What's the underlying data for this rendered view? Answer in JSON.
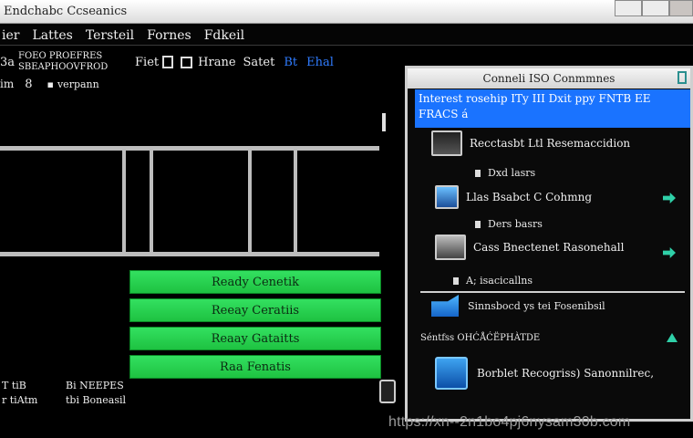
{
  "window": {
    "title": "Endchabc Ccseanics"
  },
  "menubar": {
    "items": [
      "ier",
      "Lattes",
      "Tersteil",
      "Fornes",
      "Fdkeil"
    ]
  },
  "toolbar": {
    "left_code": "3a",
    "left_text": "FOEO PROEFRES SBEAPHOOVFROD",
    "fiet": "Fiet",
    "hrane": "Hrane",
    "satet": "Satet",
    "bt": "Bt",
    "ehal": "Ehal",
    "row2_a": "im",
    "row2_b": "8",
    "row2_c": "verpann"
  },
  "ready_rows": [
    "Ready Cenetik",
    "Reeay Ceratiis",
    "Reaay Gataitts",
    "Raa Fenatis"
  ],
  "bottom_left": {
    "line1_a": "T tiB",
    "line1_b": "Bi NEEPES",
    "line2_a": "r tiAtm",
    "line2_b": "tbi Boneasil"
  },
  "panel": {
    "title": "Conneli ISO Conmmnes",
    "selected_line1": "Interest rosehip ITy III Dxit  ppy FNTB EE",
    "selected_line2": "FRACS á",
    "items": [
      {
        "label": "Recctasbt Ltl Resemaccidion",
        "sub": "Dxd lasrs"
      },
      {
        "label": "Llas Bsabct C Cohmng",
        "sub": "Ders basrs"
      },
      {
        "label": "Cass Bnectenet Rasonehall",
        "sub": "A; isacicallns"
      }
    ],
    "section_label": "Sinnsbocd ys tei Fosenibsil",
    "section_sub": "Séntfss OHĆÅĆËPHÀTDE",
    "footer_item": "Borblet Recogriss) Sanonnilrec,",
    "icons": [
      "monitor-icon",
      "arrow-right-icon",
      "folder-icon",
      "app-icon"
    ]
  },
  "watermark": "https://xn--2n1bo4pj6nysam30b.com"
}
